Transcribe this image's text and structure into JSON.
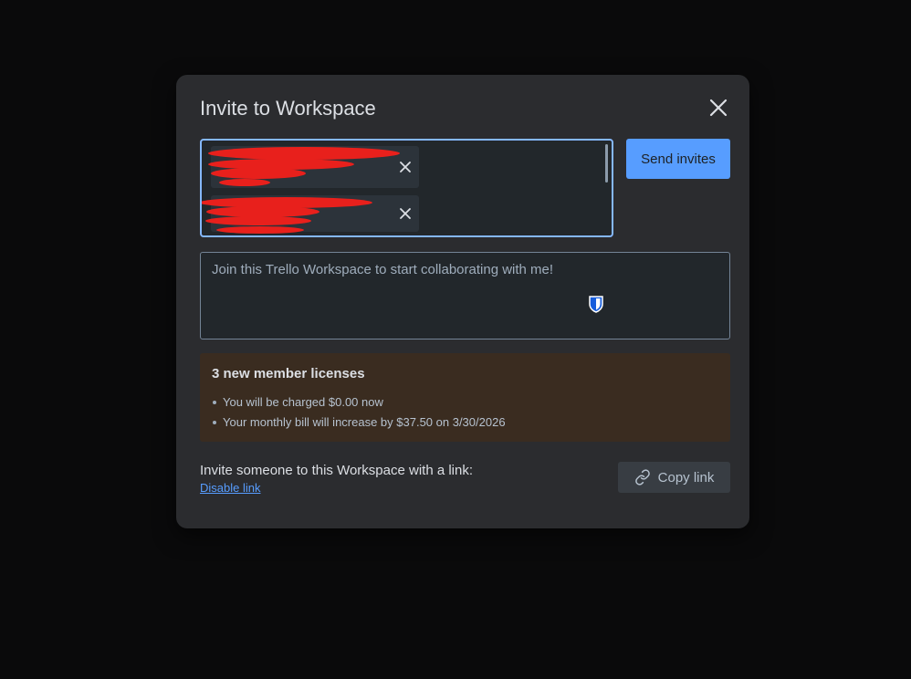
{
  "modal": {
    "title": "Invite to Workspace",
    "close_icon": "close-icon"
  },
  "invite_field": {
    "chips": [
      {
        "label": ""
      },
      {
        "label": ""
      }
    ],
    "remove_icon": "close-icon"
  },
  "send_button": {
    "label": "Send invites"
  },
  "message": {
    "placeholder": "Join this Trello Workspace to start collaborating with me!",
    "extension_icon": "shield-icon"
  },
  "licenses": {
    "title": "3 new member licenses",
    "items": [
      "You will be charged $0.00 now",
      "Your monthly bill will increase by $37.50 on 3/30/2026"
    ]
  },
  "link_section": {
    "text": "Invite someone to this Workspace with a link:",
    "disable_label": "Disable link",
    "copy_label": "Copy link",
    "copy_icon": "link-icon"
  },
  "colors": {
    "accent": "#579dff",
    "modal_bg": "#2b2c2f",
    "license_bg": "#3a2c20",
    "redaction": "#e8201c"
  }
}
